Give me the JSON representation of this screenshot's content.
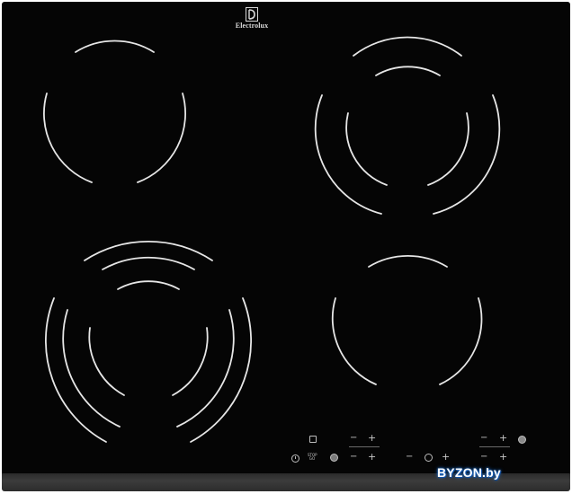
{
  "brand": {
    "name": "Electrolux",
    "logo_icon": "electrolux-logo-icon"
  },
  "cooking_zones": [
    {
      "id": "front-left",
      "rings": 3
    },
    {
      "id": "rear-left",
      "rings": 1
    },
    {
      "id": "rear-right",
      "rings": 2
    },
    {
      "id": "front-right",
      "rings": 1
    }
  ],
  "controls": {
    "minus": "−",
    "plus": "+",
    "stop_go_label": "STOP GO",
    "icons": [
      "power-icon",
      "lock-icon",
      "stop-go-icon",
      "bridge-icon",
      "timer-icon",
      "hob-to-hood-icon"
    ]
  },
  "colors": {
    "glass": "#050505",
    "rings": "#e6e6e6",
    "controls": "#c8c8c8"
  },
  "watermark": "BYZON.by"
}
